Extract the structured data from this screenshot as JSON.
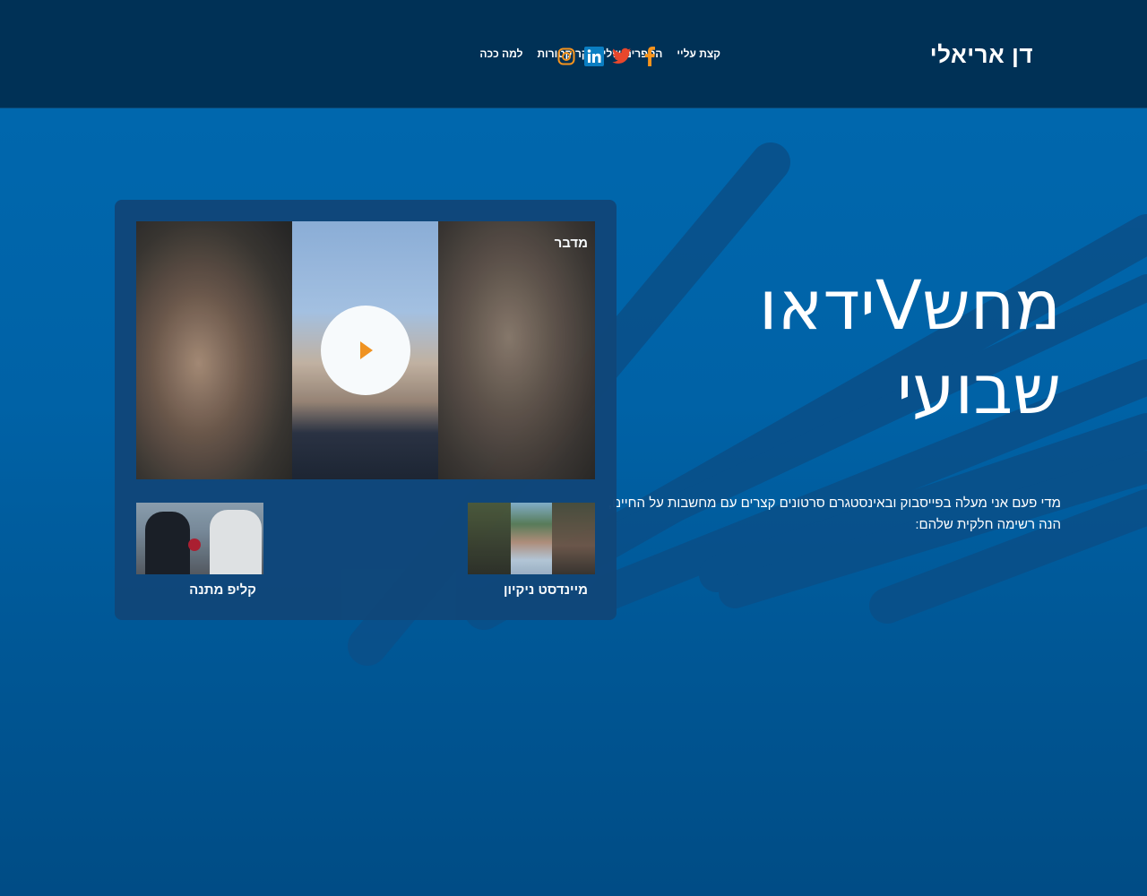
{
  "header": {
    "brand": "דן אריאלי",
    "nav": [
      {
        "label": "קצת עליי"
      },
      {
        "label": "הספרים שלי"
      },
      {
        "label": "קריקטורות"
      },
      {
        "label": "למה ככה"
      }
    ],
    "social": [
      {
        "icon": "facebook-icon",
        "color": "#f7941d"
      },
      {
        "icon": "twitter-icon",
        "color": "#e8472c"
      },
      {
        "icon": "linkedin-icon",
        "color": "#0a7ec2"
      },
      {
        "icon": "instagram-icon",
        "color": "#f7941d"
      }
    ]
  },
  "hero": {
    "title_line1": "מחשVידאו",
    "title_line2": "שבועי",
    "description_line1": "מדי פעם אני מעלה בפייסבוק ובאינסטגרם סרטונים קצרים עם מחשבות על החיים,",
    "description_line2": "הנה רשימה חלקית שלהם:"
  },
  "videos": {
    "main": {
      "title": "מדבר"
    },
    "thumbs": [
      {
        "label": "מיינדסט ניקיון"
      },
      {
        "label": "קליפ מתנה"
      }
    ],
    "play_color": "#f7941d"
  }
}
